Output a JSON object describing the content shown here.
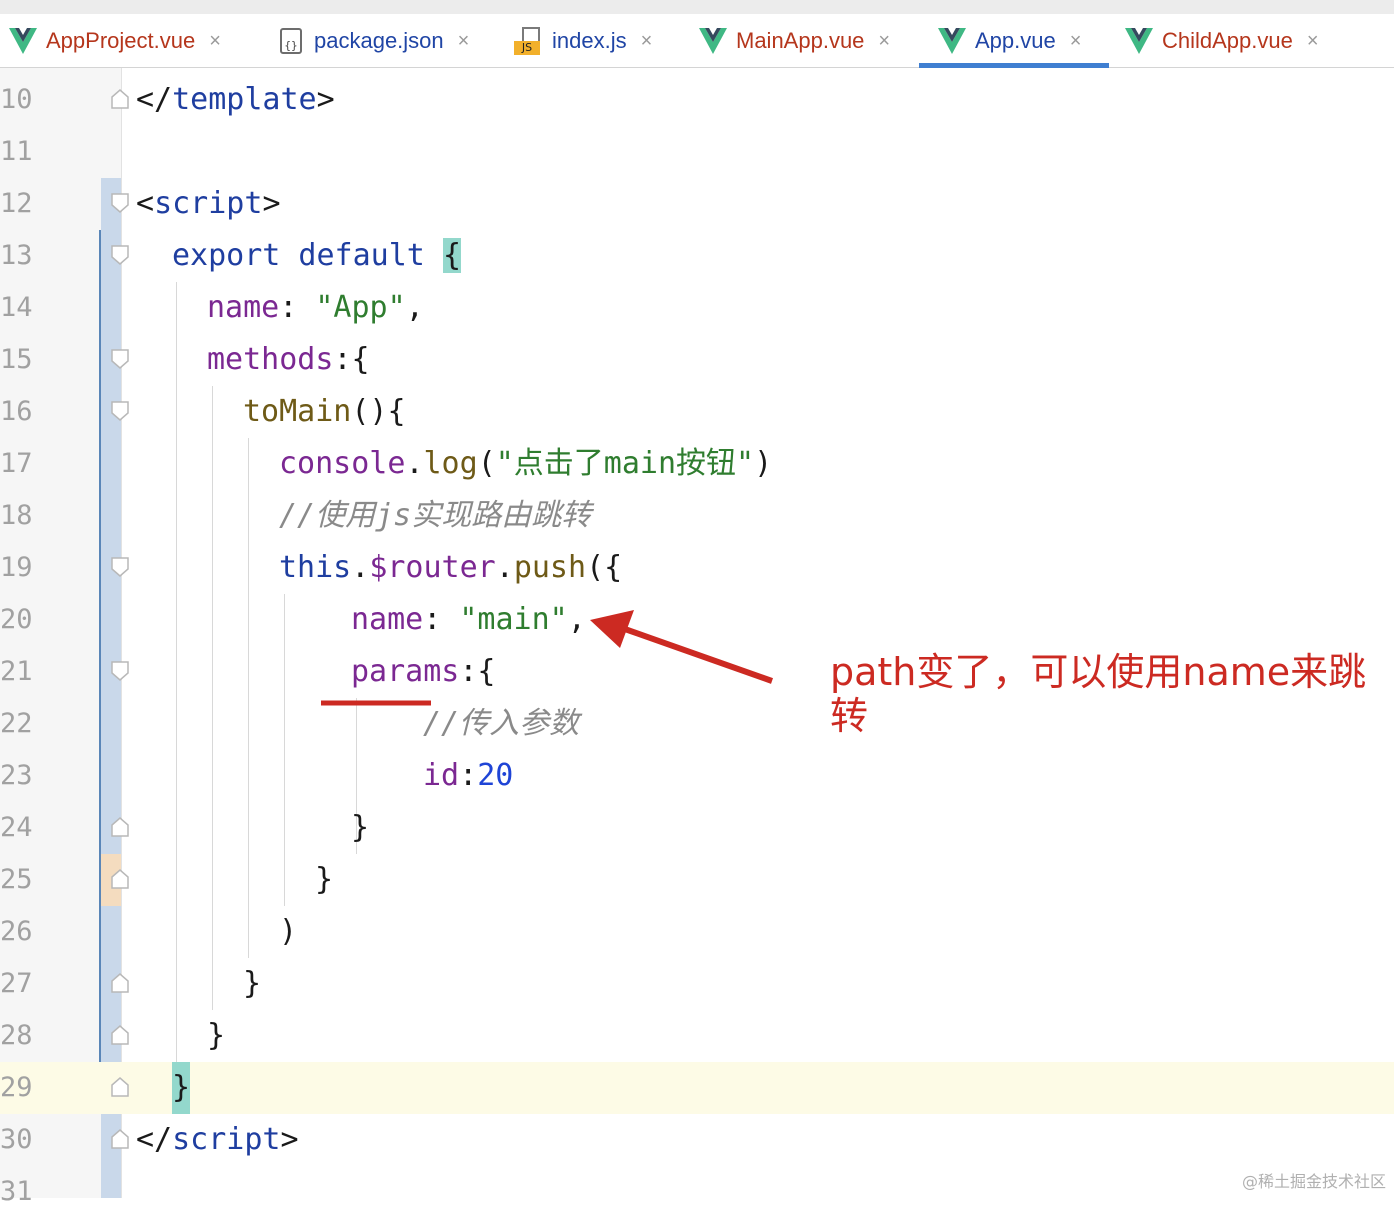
{
  "tabs": [
    {
      "label": "AppProject.vue",
      "icon": "vue-file-icon",
      "active": false
    },
    {
      "label": "package.json",
      "icon": "json-file-icon",
      "active": false
    },
    {
      "label": "index.js",
      "icon": "js-file-icon",
      "active": false
    },
    {
      "label": "MainApp.vue",
      "icon": "vue-file-icon",
      "active": false
    },
    {
      "label": "App.vue",
      "icon": "vue-file-icon",
      "active": true
    },
    {
      "label": "ChildApp.vue",
      "icon": "vue-file-icon",
      "active": false
    }
  ],
  "close_glyph": "×",
  "line_numbers": [
    "10",
    "11",
    "12",
    "13",
    "14",
    "15",
    "16",
    "17",
    "18",
    "19",
    "20",
    "21",
    "22",
    "23",
    "24",
    "25",
    "26",
    "27",
    "28",
    "29",
    "30",
    "31"
  ],
  "current_line": "29",
  "code": {
    "l10_open": "</",
    "l10_tag": "template",
    "l10_close": ">",
    "l12_open": "<",
    "l12_tag": "script",
    "l12_close": ">",
    "l13_kw": "export default ",
    "l13_brace": "{",
    "l14_prop": "name",
    "l14_colon": ": ",
    "l14_str": "\"App\"",
    "l14_comma": ",",
    "l15_prop": "methods",
    "l15_rest": ":{",
    "l16_fn": "toMain",
    "l16_rest": "(){",
    "l17_obj": "console",
    "l17_dot": ".",
    "l17_fn": "log",
    "l17_paren": "(",
    "l17_str": "\"点击了main按钮\"",
    "l17_close": ")",
    "l18_cmt": "//使用js实现路由跳转",
    "l19_kw": "this",
    "l19_dot": ".",
    "l19_prop": "$router",
    "l19_dot2": ".",
    "l19_fn": "push",
    "l19_rest": "({",
    "l20_prop": "name",
    "l20_colon": ": ",
    "l20_str": "\"main\"",
    "l20_comma": ",",
    "l21_prop": "params",
    "l21_rest": ":{",
    "l22_cmt": "//传入参数",
    "l23_prop": "id",
    "l23_colon": ":",
    "l23_num": "20",
    "l24": "}",
    "l25": "}",
    "l26": ")",
    "l27": "}",
    "l28": "}",
    "l29": "}",
    "l30_open": "</",
    "l30_tag": "script",
    "l30_close": ">"
  },
  "annotation": {
    "text": "path变了，可以使用name来跳转",
    "color": "#cc2a22"
  },
  "watermark": "@稀土掘金技术社区",
  "colors": {
    "keyword": "#1f3ea0",
    "property": "#7b2892",
    "string": "#2f7d2f",
    "number": "#1f44d6",
    "comment": "#8a8a8a",
    "active_tab_underline": "#3f7fd1",
    "vue_logo": "#3fb884"
  }
}
